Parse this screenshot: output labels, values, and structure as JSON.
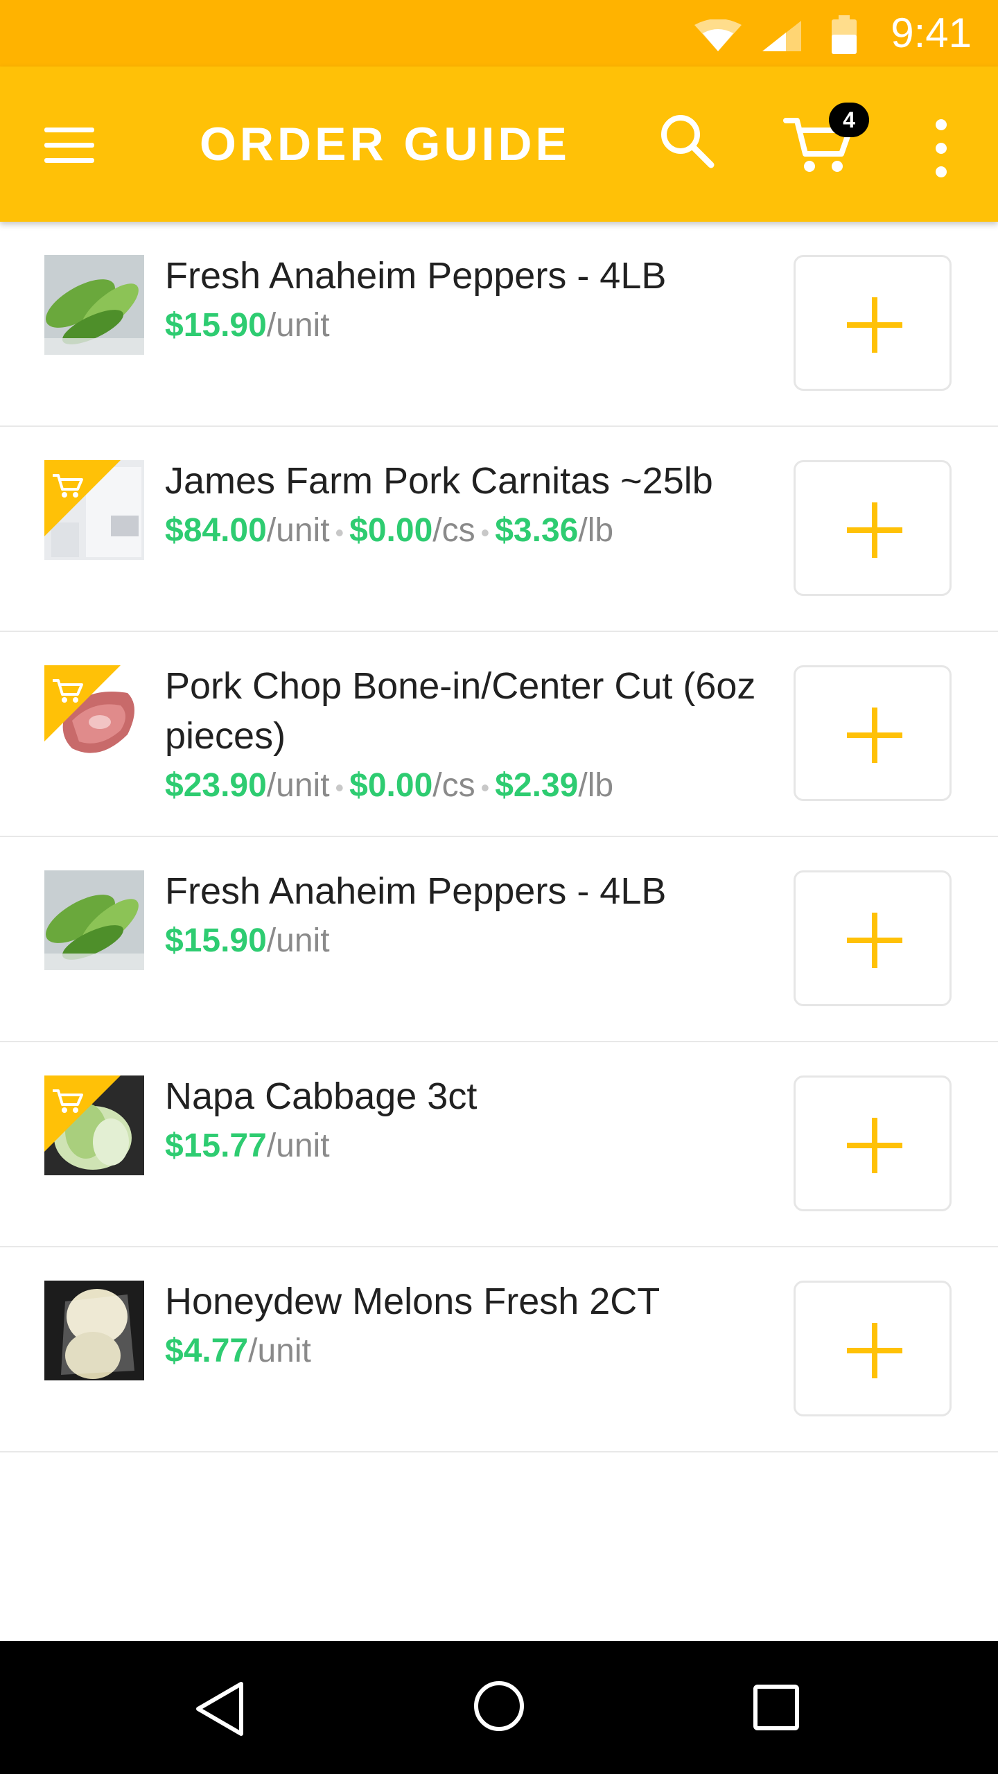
{
  "status_bar": {
    "time": "9:41"
  },
  "app_bar": {
    "title": "ORDER GUIDE",
    "cart_count": "4"
  },
  "colors": {
    "status_bar": "#FFB300",
    "app_bar": "#FFC107",
    "price_green": "#2ECC71",
    "accent_plus": "#FFC107",
    "nav_bar": "#000000"
  },
  "icons": {
    "menu": "hamburger-icon",
    "search": "search-icon",
    "cart": "cart-icon",
    "more": "more-vert-icon",
    "add": "plus-icon",
    "in_cart": "cart-flag-icon"
  },
  "products": [
    {
      "name": "Fresh Anaheim Peppers - 4LB",
      "in_cart": false,
      "prices": [
        {
          "amount": "$15.90",
          "unit": "/unit"
        }
      ]
    },
    {
      "name": "James Farm Pork Carnitas ~25lb",
      "in_cart": true,
      "prices": [
        {
          "amount": "$84.00",
          "unit": "/unit"
        },
        {
          "amount": "$0.00",
          "unit": "/cs"
        },
        {
          "amount": "$3.36",
          "unit": "/lb"
        }
      ]
    },
    {
      "name": "Pork Chop Bone-in/Center Cut (6oz pieces)",
      "in_cart": true,
      "prices": [
        {
          "amount": "$23.90",
          "unit": "/unit"
        },
        {
          "amount": "$0.00",
          "unit": "/cs"
        },
        {
          "amount": "$2.39",
          "unit": "/lb"
        }
      ]
    },
    {
      "name": "Fresh Anaheim Peppers - 4LB",
      "in_cart": false,
      "prices": [
        {
          "amount": "$15.90",
          "unit": "/unit"
        }
      ]
    },
    {
      "name": "Napa Cabbage 3ct",
      "in_cart": true,
      "prices": [
        {
          "amount": "$15.77",
          "unit": "/unit"
        }
      ]
    },
    {
      "name": "Honeydew Melons Fresh 2CT",
      "in_cart": false,
      "prices": [
        {
          "amount": "$4.77",
          "unit": "/unit"
        }
      ]
    }
  ]
}
